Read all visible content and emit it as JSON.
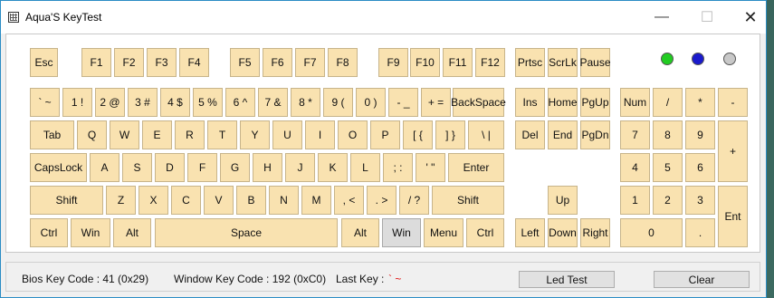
{
  "window": {
    "title": "Aqua'S KeyTest"
  },
  "leds": [
    {
      "name": "num-lock-led",
      "color": "#22cc22"
    },
    {
      "name": "caps-lock-led",
      "color": "#1a1acc"
    },
    {
      "name": "scroll-lock-led",
      "color": "#c8c8c8"
    }
  ],
  "keys": [
    {
      "label": "Esc"
    },
    {
      "label": "F1"
    },
    {
      "label": "F2"
    },
    {
      "label": "F3"
    },
    {
      "label": "F4"
    },
    {
      "label": "F5"
    },
    {
      "label": "F6"
    },
    {
      "label": "F7"
    },
    {
      "label": "F8"
    },
    {
      "label": "F9"
    },
    {
      "label": "F10"
    },
    {
      "label": "F11"
    },
    {
      "label": "F12"
    },
    {
      "label": "Prtsc"
    },
    {
      "label": "ScrLk"
    },
    {
      "label": "Pause"
    },
    {
      "label": "` ~"
    },
    {
      "label": "1 !"
    },
    {
      "label": "2 @"
    },
    {
      "label": "3 #"
    },
    {
      "label": "4 $"
    },
    {
      "label": "5 %"
    },
    {
      "label": "6 ^"
    },
    {
      "label": "7 &"
    },
    {
      "label": "8 *"
    },
    {
      "label": "9 ("
    },
    {
      "label": "0 )"
    },
    {
      "label": "- _"
    },
    {
      "label": "+ ="
    },
    {
      "label": "BackSpace"
    },
    {
      "label": "Ins"
    },
    {
      "label": "Home"
    },
    {
      "label": "PgUp"
    },
    {
      "label": "Num"
    },
    {
      "label": "/"
    },
    {
      "label": "*"
    },
    {
      "label": "-"
    },
    {
      "label": "Tab"
    },
    {
      "label": "Q"
    },
    {
      "label": "W"
    },
    {
      "label": "E"
    },
    {
      "label": "R"
    },
    {
      "label": "T"
    },
    {
      "label": "Y"
    },
    {
      "label": "U"
    },
    {
      "label": "I"
    },
    {
      "label": "O"
    },
    {
      "label": "P"
    },
    {
      "label": "[ {"
    },
    {
      "label": "] }"
    },
    {
      "label": "\\ |"
    },
    {
      "label": "Del"
    },
    {
      "label": "End"
    },
    {
      "label": "PgDn"
    },
    {
      "label": "7"
    },
    {
      "label": "8"
    },
    {
      "label": "9"
    },
    {
      "label": "+"
    },
    {
      "label": "CapsLock"
    },
    {
      "label": "A"
    },
    {
      "label": "S"
    },
    {
      "label": "D"
    },
    {
      "label": "F"
    },
    {
      "label": "G"
    },
    {
      "label": "H"
    },
    {
      "label": "J"
    },
    {
      "label": "K"
    },
    {
      "label": "L"
    },
    {
      "label": "; :"
    },
    {
      "label": "' \""
    },
    {
      "label": "Enter"
    },
    {
      "label": "4"
    },
    {
      "label": "5"
    },
    {
      "label": "6"
    },
    {
      "label": "Shift"
    },
    {
      "label": "Z"
    },
    {
      "label": "X"
    },
    {
      "label": "C"
    },
    {
      "label": "V"
    },
    {
      "label": "B"
    },
    {
      "label": "N"
    },
    {
      "label": "M"
    },
    {
      "label": ", <"
    },
    {
      "label": ". >"
    },
    {
      "label": "/ ?"
    },
    {
      "label": "Shift"
    },
    {
      "label": "Up"
    },
    {
      "label": "1"
    },
    {
      "label": "2"
    },
    {
      "label": "3"
    },
    {
      "label": "Ent"
    },
    {
      "label": "Ctrl"
    },
    {
      "label": "Win"
    },
    {
      "label": "Alt"
    },
    {
      "label": "Space"
    },
    {
      "label": "Alt"
    },
    {
      "label": "Win",
      "pressed": true
    },
    {
      "label": "Menu"
    },
    {
      "label": "Ctrl"
    },
    {
      "label": "Left"
    },
    {
      "label": "Down"
    },
    {
      "label": "Right"
    },
    {
      "label": "0"
    },
    {
      "label": "."
    }
  ],
  "status": {
    "bios_key_code": "Bios Key Code : 41 (0x29)",
    "window_key_code": "Window Key Code : 192 (0xC0)",
    "last_key_label": "Last Key :",
    "last_key_value": "` ~"
  },
  "buttons": {
    "led_test": "Led Test",
    "clear": "Clear"
  }
}
